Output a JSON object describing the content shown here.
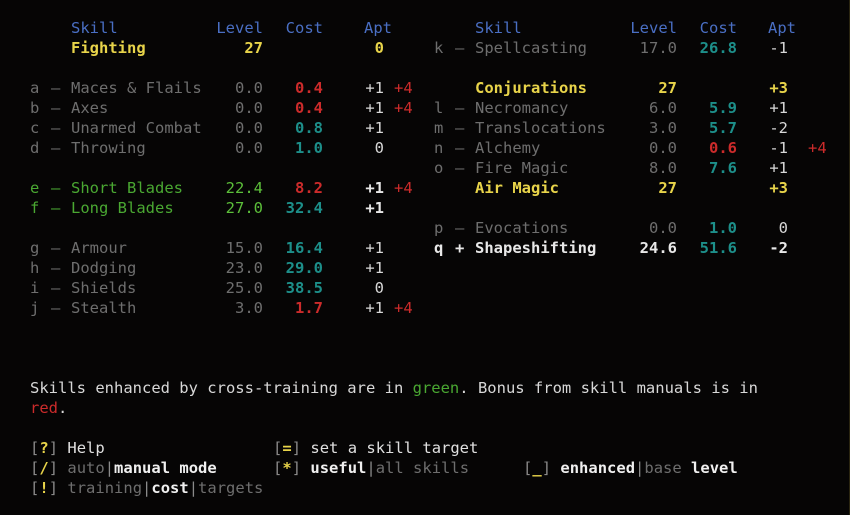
{
  "screen": {
    "title": "skills-screen",
    "background": "#060505"
  },
  "colors": {
    "header": "#4a6fc4",
    "maxed": "#e8d44a",
    "training": "#e8e8e8",
    "untrained": "#6e6e6e",
    "crosstrained": "#4aa832",
    "cost_normal": "#1d8f8a",
    "cost_manual": "#cc2b2b",
    "manual_bonus": "#cc2b2b"
  },
  "columns": {
    "left": {
      "header": {
        "skill": "Skill",
        "level": "Level",
        "cost": "Cost",
        "apt": "Apt"
      }
    },
    "right": {
      "header": {
        "skill": "Skill",
        "level": "Level",
        "cost": "Cost",
        "apt": "Apt"
      }
    }
  },
  "left_skills": [
    {
      "key": "",
      "sep": "",
      "name": "Fighting",
      "level": "27",
      "cost": "",
      "apt": "0",
      "bonus": "",
      "style": "maxed",
      "cost_style": "none"
    },
    {
      "key": "a",
      "sep": "–",
      "name": "Maces & Flails",
      "level": "0.0",
      "cost": "0.4",
      "apt": "+1",
      "bonus": "+4",
      "style": "untrained",
      "cost_style": "manual"
    },
    {
      "key": "b",
      "sep": "–",
      "name": "Axes",
      "level": "0.0",
      "cost": "0.4",
      "apt": "+1",
      "bonus": "+4",
      "style": "untrained",
      "cost_style": "manual"
    },
    {
      "key": "c",
      "sep": "–",
      "name": "Unarmed Combat",
      "level": "0.0",
      "cost": "0.8",
      "apt": "+1",
      "bonus": "",
      "style": "untrained",
      "cost_style": "normal"
    },
    {
      "key": "d",
      "sep": "–",
      "name": "Throwing",
      "level": "0.0",
      "cost": "1.0",
      "apt": "0",
      "bonus": "",
      "style": "untrained",
      "cost_style": "normal"
    },
    {
      "key": "e",
      "sep": "–",
      "name": "Short Blades",
      "level": "22.4",
      "cost": "8.2",
      "apt": "+1",
      "bonus": "+4",
      "style": "crosstrained",
      "cost_style": "manual"
    },
    {
      "key": "f",
      "sep": "–",
      "name": "Long Blades",
      "level": "27.0",
      "cost": "32.4",
      "apt": "+1",
      "bonus": "",
      "style": "crosstrained",
      "cost_style": "normal"
    },
    {
      "key": "g",
      "sep": "–",
      "name": "Armour",
      "level": "15.0",
      "cost": "16.4",
      "apt": "+1",
      "bonus": "",
      "style": "untrained",
      "cost_style": "normal"
    },
    {
      "key": "h",
      "sep": "–",
      "name": "Dodging",
      "level": "23.0",
      "cost": "29.0",
      "apt": "+1",
      "bonus": "",
      "style": "untrained",
      "cost_style": "normal"
    },
    {
      "key": "i",
      "sep": "–",
      "name": "Shields",
      "level": "25.0",
      "cost": "38.5",
      "apt": "0",
      "bonus": "",
      "style": "untrained",
      "cost_style": "normal"
    },
    {
      "key": "j",
      "sep": "–",
      "name": "Stealth",
      "level": "3.0",
      "cost": "1.7",
      "apt": "+1",
      "bonus": "+4",
      "style": "untrained",
      "cost_style": "manual"
    }
  ],
  "right_skills": [
    {
      "key": "k",
      "sep": "–",
      "name": "Spellcasting",
      "level": "17.0",
      "cost": "26.8",
      "apt": "-1",
      "bonus": "",
      "style": "untrained",
      "cost_style": "normal"
    },
    {
      "key": "",
      "sep": "",
      "name": "Conjurations",
      "level": "27",
      "cost": "",
      "apt": "+3",
      "bonus": "",
      "style": "maxed",
      "cost_style": "none"
    },
    {
      "key": "l",
      "sep": "–",
      "name": "Necromancy",
      "level": "6.0",
      "cost": "5.9",
      "apt": "+1",
      "bonus": "",
      "style": "untrained",
      "cost_style": "normal"
    },
    {
      "key": "m",
      "sep": "–",
      "name": "Translocations",
      "level": "3.0",
      "cost": "5.7",
      "apt": "-2",
      "bonus": "",
      "style": "untrained",
      "cost_style": "normal"
    },
    {
      "key": "n",
      "sep": "–",
      "name": "Alchemy",
      "level": "0.0",
      "cost": "0.6",
      "apt": "-1",
      "bonus": "+4",
      "style": "untrained",
      "cost_style": "manual"
    },
    {
      "key": "o",
      "sep": "–",
      "name": "Fire Magic",
      "level": "8.0",
      "cost": "7.6",
      "apt": "+1",
      "bonus": "",
      "style": "untrained",
      "cost_style": "normal"
    },
    {
      "key": "",
      "sep": "",
      "name": "Air Magic",
      "level": "27",
      "cost": "",
      "apt": "+3",
      "bonus": "",
      "style": "maxed",
      "cost_style": "none"
    },
    {
      "key": "p",
      "sep": "–",
      "name": "Evocations",
      "level": "0.0",
      "cost": "1.0",
      "apt": "0",
      "bonus": "",
      "style": "untrained",
      "cost_style": "normal"
    },
    {
      "key": "q",
      "sep": "+",
      "name": "Shapeshifting",
      "level": "24.6",
      "cost": "51.6",
      "apt": "-2",
      "bonus": "",
      "style": "training",
      "cost_style": "normal"
    }
  ],
  "legend": {
    "part1": "Skills enhanced by cross-training are in ",
    "green_word": "green",
    "part2": ". Bonus from skill manuals is in",
    "red_word": "red",
    "part3": "."
  },
  "commands": {
    "help": {
      "bracket_open": "[",
      "key": "?",
      "bracket_close": "]",
      "label": "Help"
    },
    "target": {
      "bracket_open": "[",
      "key": "=",
      "bracket_close": "]",
      "label": "set a skill target"
    },
    "mode": {
      "bracket_open": "[",
      "key": "/",
      "bracket_close": "]",
      "option_a": "auto",
      "divider": "|",
      "option_b": "manual",
      "suffix": " mode",
      "selected": "manual"
    },
    "filter": {
      "bracket_open": "[",
      "key": "*",
      "bracket_close": "]",
      "option_a": "useful",
      "divider": "|",
      "option_b": "all",
      "suffix": " skills",
      "selected": "useful"
    },
    "levelmode": {
      "bracket_open": "[",
      "key": "_",
      "bracket_close": "]",
      "option_a": "enhanced",
      "divider": "|",
      "option_b": "base",
      "suffix": " level",
      "selected": "enhanced"
    },
    "display": {
      "bracket_open": "[",
      "key": "!",
      "bracket_close": "]",
      "option_a": "training",
      "divider1": "|",
      "option_b": "cost",
      "divider2": "|",
      "option_c": "targets",
      "selected": "cost"
    }
  }
}
